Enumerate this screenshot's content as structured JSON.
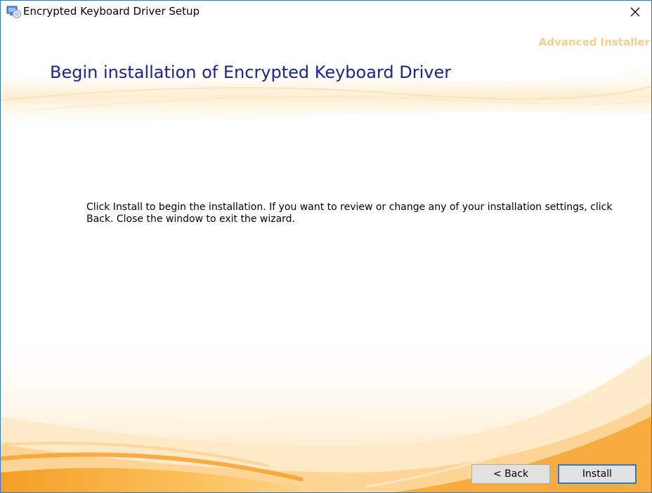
{
  "window": {
    "title": "Encrypted Keyboard Driver Setup",
    "close_glyph": "×"
  },
  "branding": {
    "watermark": "Advanced Installer"
  },
  "main": {
    "heading": "Begin installation of Encrypted Keyboard Driver",
    "instructions": "Click Install to begin the installation.  If you want to review or change any of your installation settings, click Back.  Close the window to exit the wizard."
  },
  "buttons": {
    "back_label": "< Back",
    "install_label": "Install"
  },
  "colors": {
    "accent": "#1a2591",
    "window_border": "#2b79d6",
    "wave_orange": "#f8a62a"
  },
  "icons": {
    "app": "setup-disc-icon",
    "close": "close-icon"
  }
}
